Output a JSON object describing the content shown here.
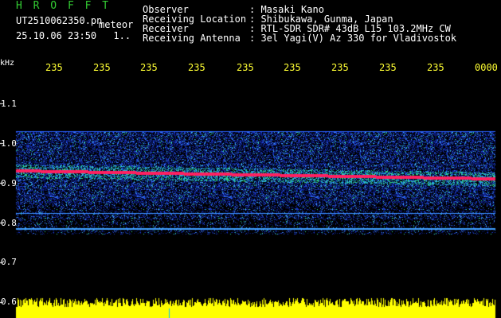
{
  "header": {
    "app_title": "H R O F F T",
    "file_name": "UT2510062350.pn",
    "file_type": "meteor",
    "date_time": "25.10.06 23:50",
    "counter": "1..",
    "info": [
      {
        "label": "Observer",
        "value": ": Masaki Kano"
      },
      {
        "label": "Receiving Location",
        "value": ": Shibukawa, Gunma, Japan"
      },
      {
        "label": "Receiver",
        "value": ": RTL-SDR SDR# 43dB L15 103.2MHz CW"
      },
      {
        "label": "Receiving Antenna",
        "value": ": 3el Yagi(V) Az 330 for Vladivostok"
      }
    ]
  },
  "time_axis": {
    "labels": [
      "235",
      "235",
      "235",
      "235",
      "235",
      "235",
      "235",
      "235",
      "235",
      "0000"
    ]
  },
  "freq_axis": {
    "unit": "kHz",
    "labels": [
      "1.1",
      "1.0",
      "0.9",
      "0.8",
      "0.7",
      "0.6"
    ]
  },
  "colors": {
    "background": "#000000",
    "title": "#33cc33",
    "time_labels": "#ffff33",
    "spectrum_bars": "#ffff00",
    "signal_carrier": "#ff2060",
    "noise": "#1030c0"
  }
}
